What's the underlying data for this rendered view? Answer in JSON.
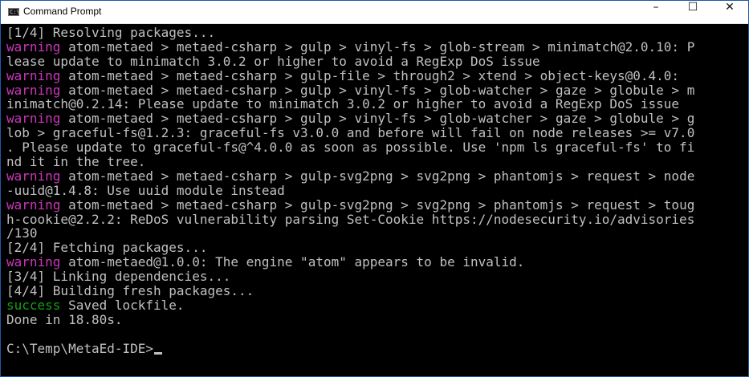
{
  "window": {
    "title": "Command Prompt",
    "icon": "command-prompt-icon",
    "icon_glyph": "C:\\",
    "controls": {
      "minimize": "–",
      "maximize": "☐",
      "close": "✕"
    }
  },
  "colors": {
    "background": "#000000",
    "text": "#c0c0c0",
    "warning": "#c837b7",
    "success": "#13a10e"
  },
  "console": {
    "lines": [
      {
        "text": "[1/4] Resolving packages..."
      },
      {
        "prefix": "warning",
        "text": " atom-metaed > metaed-csharp > gulp > vinyl-fs > glob-stream > minimatch@2.0.10: P"
      },
      {
        "text": "lease update to minimatch 3.0.2 or higher to avoid a RegExp DoS issue"
      },
      {
        "prefix": "warning",
        "text": " atom-metaed > metaed-csharp > gulp-file > through2 > xtend > object-keys@0.4.0:"
      },
      {
        "prefix": "warning",
        "text": " atom-metaed > metaed-csharp > gulp > vinyl-fs > glob-watcher > gaze > globule > m"
      },
      {
        "text": "inimatch@0.2.14: Please update to minimatch 3.0.2 or higher to avoid a RegExp DoS issue"
      },
      {
        "prefix": "warning",
        "text": " atom-metaed > metaed-csharp > gulp > vinyl-fs > glob-watcher > gaze > globule > g"
      },
      {
        "text": "lob > graceful-fs@1.2.3: graceful-fs v3.0.0 and before will fail on node releases >= v7.0"
      },
      {
        "text": ". Please update to graceful-fs@^4.0.0 as soon as possible. Use 'npm ls graceful-fs' to fi"
      },
      {
        "text": "nd it in the tree."
      },
      {
        "prefix": "warning",
        "text": " atom-metaed > metaed-csharp > gulp-svg2png > svg2png > phantomjs > request > node"
      },
      {
        "text": "-uuid@1.4.8: Use uuid module instead"
      },
      {
        "prefix": "warning",
        "text": " atom-metaed > metaed-csharp > gulp-svg2png > svg2png > phantomjs > request > toug"
      },
      {
        "text": "h-cookie@2.2.2: ReDoS vulnerability parsing Set-Cookie https://nodesecurity.io/advisories"
      },
      {
        "text": "/130"
      },
      {
        "text": "[2/4] Fetching packages..."
      },
      {
        "prefix": "warning",
        "text": " atom-metaed@1.0.0: The engine \"atom\" appears to be invalid."
      },
      {
        "text": "[3/4] Linking dependencies..."
      },
      {
        "text": "[4/4] Building fresh packages..."
      },
      {
        "prefix": "success",
        "text": " Saved lockfile."
      },
      {
        "text": "Done in 18.80s."
      },
      {
        "text": ""
      },
      {
        "text": "C:\\Temp\\MetaEd-IDE>",
        "cursor": true
      }
    ]
  }
}
